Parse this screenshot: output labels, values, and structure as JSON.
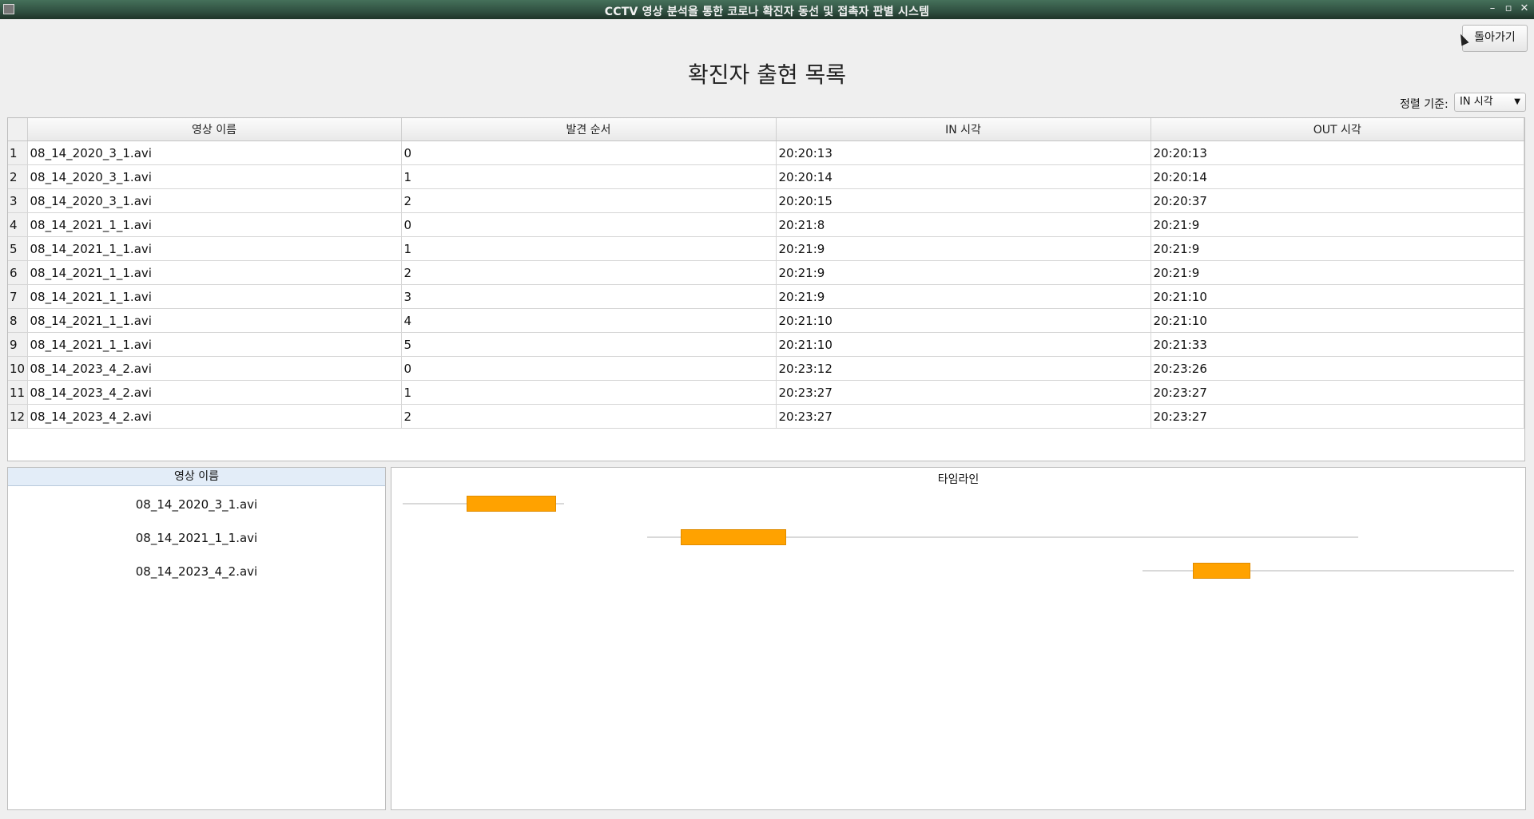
{
  "window": {
    "title": "CCTV 영상 분석을 통한 코로나 확진자 동선 및 접촉자 판별 시스템"
  },
  "header": {
    "title": "확진자 출현 목록",
    "back_label": "돌아가기",
    "sort_label": "정렬 기준:",
    "sort_value": "IN 시각"
  },
  "table": {
    "columns": [
      "영상 이름",
      "발견 순서",
      "IN 시각",
      "OUT 시각"
    ],
    "rows": [
      [
        "1",
        "08_14_2020_3_1.avi",
        "0",
        "20:20:13",
        "20:20:13"
      ],
      [
        "2",
        "08_14_2020_3_1.avi",
        "1",
        "20:20:14",
        "20:20:14"
      ],
      [
        "3",
        "08_14_2020_3_1.avi",
        "2",
        "20:20:15",
        "20:20:37"
      ],
      [
        "4",
        "08_14_2021_1_1.avi",
        "0",
        "20:21:8",
        "20:21:9"
      ],
      [
        "5",
        "08_14_2021_1_1.avi",
        "1",
        "20:21:9",
        "20:21:9"
      ],
      [
        "6",
        "08_14_2021_1_1.avi",
        "2",
        "20:21:9",
        "20:21:9"
      ],
      [
        "7",
        "08_14_2021_1_1.avi",
        "3",
        "20:21:9",
        "20:21:10"
      ],
      [
        "8",
        "08_14_2021_1_1.avi",
        "4",
        "20:21:10",
        "20:21:10"
      ],
      [
        "9",
        "08_14_2021_1_1.avi",
        "5",
        "20:21:10",
        "20:21:33"
      ],
      [
        "10",
        "08_14_2023_4_2.avi",
        "0",
        "20:23:12",
        "20:23:26"
      ],
      [
        "11",
        "08_14_2023_4_2.avi",
        "1",
        "20:23:27",
        "20:23:27"
      ],
      [
        "12",
        "08_14_2023_4_2.avi",
        "2",
        "20:23:27",
        "20:23:27"
      ]
    ]
  },
  "video_list": {
    "header": "영상 이름",
    "items": [
      "08_14_2020_3_1.avi",
      "08_14_2021_1_1.avi",
      "08_14_2023_4_2.avi"
    ]
  },
  "timeline": {
    "title": "타임라인",
    "bar_color": "#ffa200",
    "tracks": [
      {
        "video": "08_14_2020_3_1.avi",
        "bar_start": "20:20:13",
        "bar_end": "20:20:37"
      },
      {
        "video": "08_14_2021_1_1.avi",
        "bar_start": "20:21:8",
        "bar_end": "20:21:33"
      },
      {
        "video": "08_14_2023_4_2.avi",
        "bar_start": "20:23:12",
        "bar_end": "20:23:27"
      }
    ]
  }
}
